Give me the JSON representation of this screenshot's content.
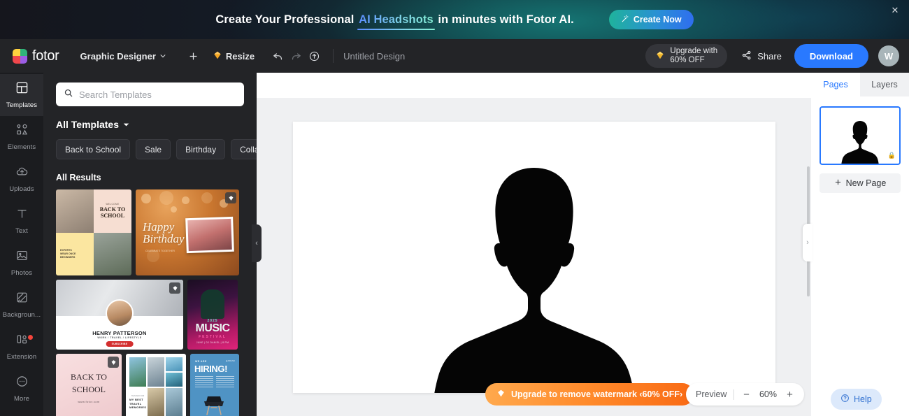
{
  "promo": {
    "text_before": "Create Your Professional ",
    "highlight": "AI Headshots",
    "text_after": " in minutes with Fotor AI.",
    "cta_label": "Create Now",
    "cta_icon": "magic-wand-icon",
    "close_icon": "close-icon",
    "gradient_from": "#15161d",
    "gradient_to": "#0c0f16",
    "cta_gradient_from": "#1fb39b",
    "cta_gradient_to": "#2f6df0"
  },
  "header": {
    "logo_text": "fotor",
    "mode": "Graphic Designer",
    "add_icon": "plus-icon",
    "resize_label": "Resize",
    "resize_icon": "resize-diamond-icon",
    "undo_icon": "undo-icon",
    "redo_icon": "redo-icon",
    "cloud_icon": "cloud-upload-icon",
    "document_title": "Untitled Design",
    "upgrade_line1": "Upgrade with",
    "upgrade_line2": "60% OFF",
    "upgrade_icon": "diamond-icon",
    "share_label": "Share",
    "share_icon": "share-icon",
    "download_label": "Download",
    "avatar_initial": "W",
    "accent": "#2979ff"
  },
  "sidebar": {
    "items": [
      {
        "label": "Templates",
        "icon": "templates-grid-icon",
        "active": true,
        "dot": false
      },
      {
        "label": "Elements",
        "icon": "elements-shapes-icon",
        "active": false,
        "dot": false
      },
      {
        "label": "Uploads",
        "icon": "cloud-upload-icon",
        "active": false,
        "dot": false
      },
      {
        "label": "Text",
        "icon": "text-t-icon",
        "active": false,
        "dot": false
      },
      {
        "label": "Photos",
        "icon": "photo-image-icon",
        "active": false,
        "dot": false
      },
      {
        "label": "Backgroun...",
        "icon": "background-pattern-icon",
        "active": false,
        "dot": false
      },
      {
        "label": "Extension",
        "icon": "extension-icon",
        "active": false,
        "dot": true
      },
      {
        "label": "More",
        "icon": "more-dots-icon",
        "active": false,
        "dot": false
      }
    ]
  },
  "panel": {
    "search_placeholder": "Search Templates",
    "search_value": "",
    "search_icon": "search-icon",
    "all_templates_label": "All Templates",
    "dropdown_icon": "chevron-down-icon",
    "chips": [
      "Back to School",
      "Sale",
      "Birthday",
      "Collage"
    ],
    "chips_next_icon": "chevron-right-icon",
    "all_results_label": "All Results",
    "templates": [
      {
        "name": "back-to-school-collage",
        "welcome": "WELCOME",
        "title": "BACK TO\nSCHOOL",
        "caption": "EXPERTS\nWEAR ONCE\nBEGINNERS",
        "premium": false
      },
      {
        "name": "happy-birthday",
        "title": "Happy\nBirthday",
        "subtitle": "CELEBRATE TOGETHER",
        "premium": true
      },
      {
        "name": "youtube-channel-banner",
        "title": "HENRY PATTERSON",
        "subtitle": "WORK / TRAVEL / LIFESTYLE",
        "button": "SUBSCRIBE",
        "premium": true
      },
      {
        "name": "music-festival-poster",
        "year": "2025",
        "title": "MUSIC",
        "subtitle": "FESTIVAL",
        "info": "JUNE  |  DJ DANIEL  |  8 PM",
        "premium": false
      },
      {
        "name": "back-to-school-pink",
        "title": "BACK TO\nSCHOOL",
        "url": "www.fotor.com",
        "premium": true
      },
      {
        "name": "travel-memories-collage",
        "kicker": "THIS WAY FOR",
        "title": "MY BEST\nTRAVEL\nMEMORIES",
        "premium": false
      },
      {
        "name": "we-are-hiring-poster",
        "kicker": "WE ARE",
        "title": "HIRING!",
        "premium": false
      }
    ]
  },
  "canvas": {
    "page_content": "person-silhouette",
    "collapse_left_icon": "chevron-left-icon",
    "collapse_right_icon": "chevron-right-icon"
  },
  "bottombar": {
    "watermark_label": "Upgrade to remove watermark ‹60% OFF›",
    "watermark_icon": "diamond-icon",
    "preview_label": "Preview",
    "zoom_out_icon": "minus-icon",
    "zoom_value": "60%",
    "zoom_in_icon": "plus-icon"
  },
  "rightpanel": {
    "tabs": [
      {
        "label": "Pages",
        "active": true
      },
      {
        "label": "Layers",
        "active": false
      }
    ],
    "page_thumb_name": "page-1-thumbnail",
    "lock_icon": "lock-icon",
    "new_page_label": "New Page",
    "new_page_icon": "plus-icon",
    "help_label": "Help",
    "help_icon": "question-circle-icon"
  }
}
